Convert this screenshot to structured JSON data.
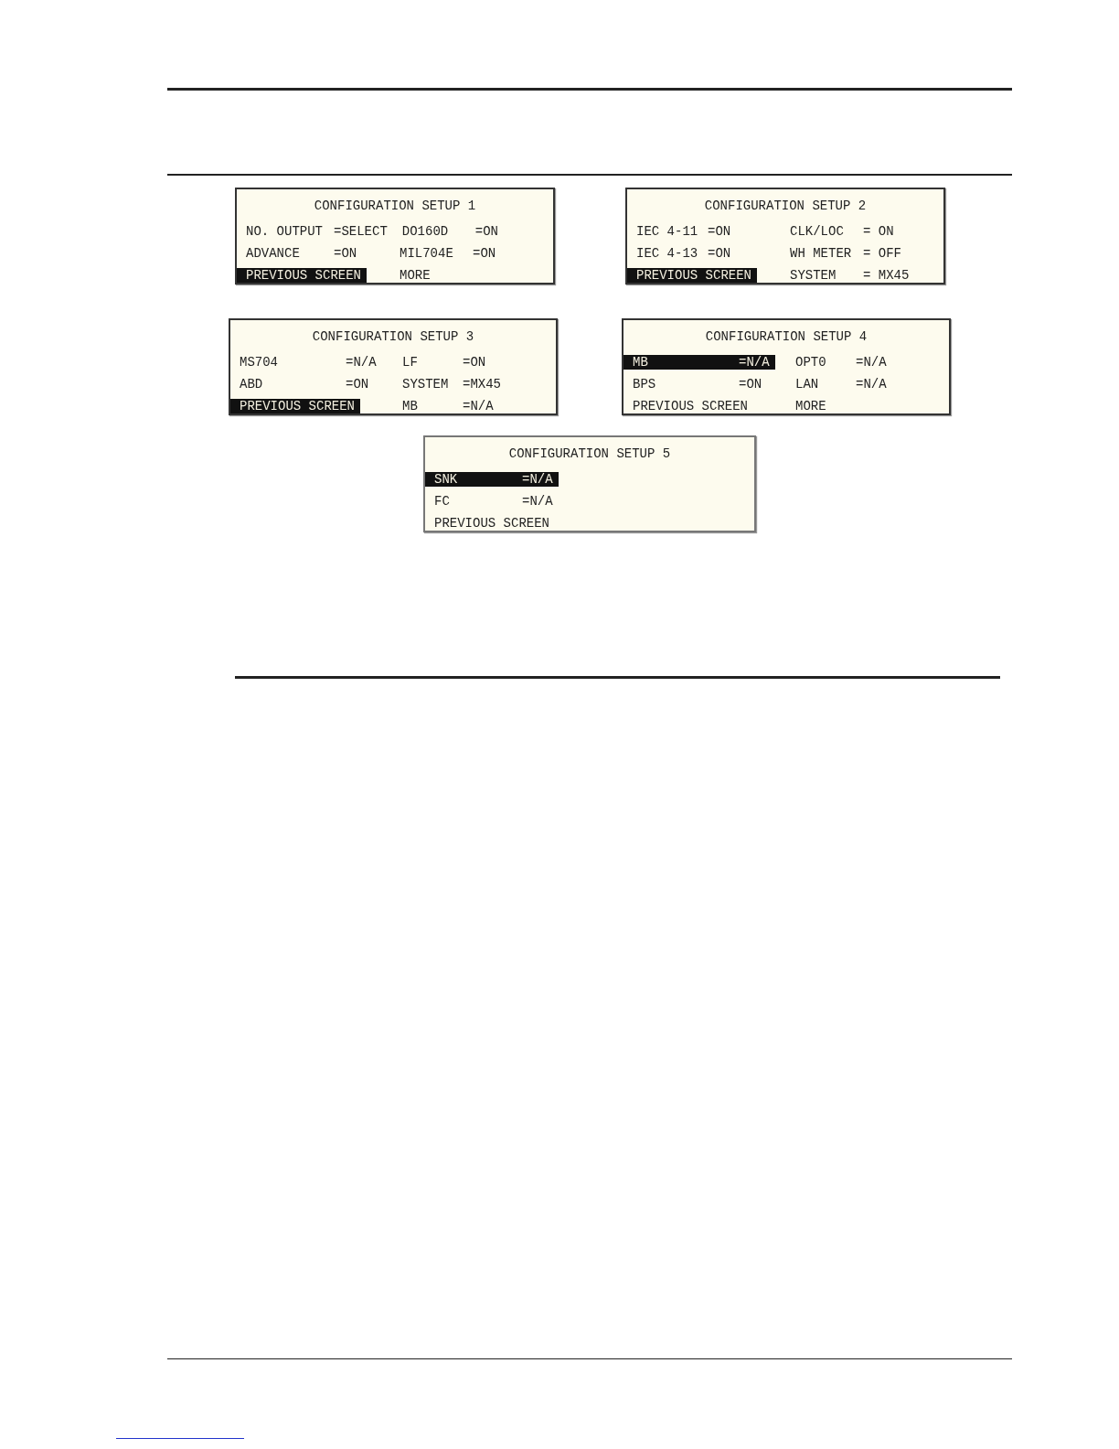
{
  "screens": [
    {
      "title": "CONFIGURATION SETUP 1",
      "rows": [
        {
          "cells": [
            {
              "label": "NO. OUTPUT",
              "value": "=SELECT",
              "selected": false
            },
            {
              "label": "DO160D",
              "value": "=ON",
              "selected": false
            }
          ]
        },
        {
          "cells": [
            {
              "label": "ADVANCE",
              "value": "=ON",
              "selected": false
            },
            {
              "label": "MIL704E",
              "value": "=ON",
              "selected": false
            }
          ]
        },
        {
          "cells": [
            {
              "label": "PREVIOUS SCREEN",
              "selected": true
            },
            {
              "label": "MORE",
              "selected": false
            }
          ]
        }
      ]
    },
    {
      "title": "CONFIGURATION SETUP 2",
      "rows": [
        {
          "cells": [
            {
              "label": "IEC 4-11",
              "value": "=ON",
              "selected": false
            },
            {
              "label": "CLK/LOC",
              "value": "= ON",
              "selected": false
            }
          ]
        },
        {
          "cells": [
            {
              "label": "IEC 4-13",
              "value": "=ON",
              "selected": false
            },
            {
              "label": "WH METER",
              "value": "= OFF",
              "selected": false
            }
          ]
        },
        {
          "cells": [
            {
              "label": "PREVIOUS SCREEN",
              "selected": true
            },
            {
              "label": "SYSTEM",
              "value": "= MX45",
              "selected": false
            }
          ]
        }
      ]
    },
    {
      "title": "CONFIGURATION SETUP 3",
      "rows": [
        {
          "cells": [
            {
              "label": "MS704",
              "value": "=N/A",
              "selected": false
            },
            {
              "label": "LF",
              "value": "=ON",
              "selected": false
            }
          ]
        },
        {
          "cells": [
            {
              "label": "ABD",
              "value": "=ON",
              "selected": false
            },
            {
              "label": "SYSTEM",
              "value": "=MX45",
              "selected": false
            }
          ]
        },
        {
          "cells": [
            {
              "label": "PREVIOUS SCREEN",
              "selected": true
            },
            {
              "label": "MB",
              "value": "=N/A",
              "selected": false
            }
          ]
        }
      ]
    },
    {
      "title": "CONFIGURATION SETUP 4",
      "rows": [
        {
          "cells": [
            {
              "label": "MB",
              "value": "=N/A",
              "selected": true
            },
            {
              "label": "OPT0",
              "value": "=N/A",
              "selected": false
            }
          ]
        },
        {
          "cells": [
            {
              "label": "BPS",
              "value": "=ON",
              "selected": false
            },
            {
              "label": "LAN",
              "value": "=N/A",
              "selected": false
            }
          ]
        },
        {
          "cells": [
            {
              "label": "PREVIOUS SCREEN",
              "selected": false
            },
            {
              "label": "MORE",
              "selected": false
            }
          ]
        }
      ]
    },
    {
      "title": "CONFIGURATION SETUP 5",
      "rows": [
        {
          "cells": [
            {
              "label": "SNK",
              "value": "=N/A",
              "selected": true
            }
          ]
        },
        {
          "cells": [
            {
              "label": "FC",
              "value": "=N/A",
              "selected": false
            }
          ]
        },
        {
          "cells": [
            {
              "label": "PREVIOUS SCREEN",
              "selected": false
            }
          ]
        }
      ]
    }
  ]
}
